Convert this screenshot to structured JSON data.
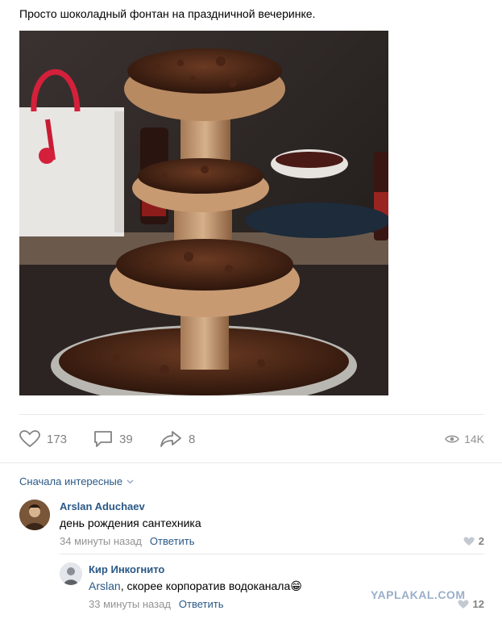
{
  "post": {
    "text": "Просто шоколадный фонтан на праздничной вечеринке."
  },
  "actions": {
    "likes": "173",
    "comments": "39",
    "shares": "8",
    "views": "14K"
  },
  "comments_sort": {
    "label": "Сначала интересные"
  },
  "comments": [
    {
      "author": "Arslan Aduchaev",
      "text": "день рождения сантехника",
      "time": "34 минуты назад",
      "reply_label": "Ответить",
      "likes": "2"
    },
    {
      "author": "Кир Инкогнито",
      "mention": "Arslan",
      "text": ", скорее корпоратив водоканала",
      "emoji": "😁",
      "time": "33 минуты назад",
      "reply_label": "Ответить",
      "likes": "12"
    }
  ],
  "watermark": "YAPLAKAL.COM",
  "colors": {
    "link": "#2a5885",
    "muted": "#939393",
    "divider": "#e7e8ec"
  }
}
